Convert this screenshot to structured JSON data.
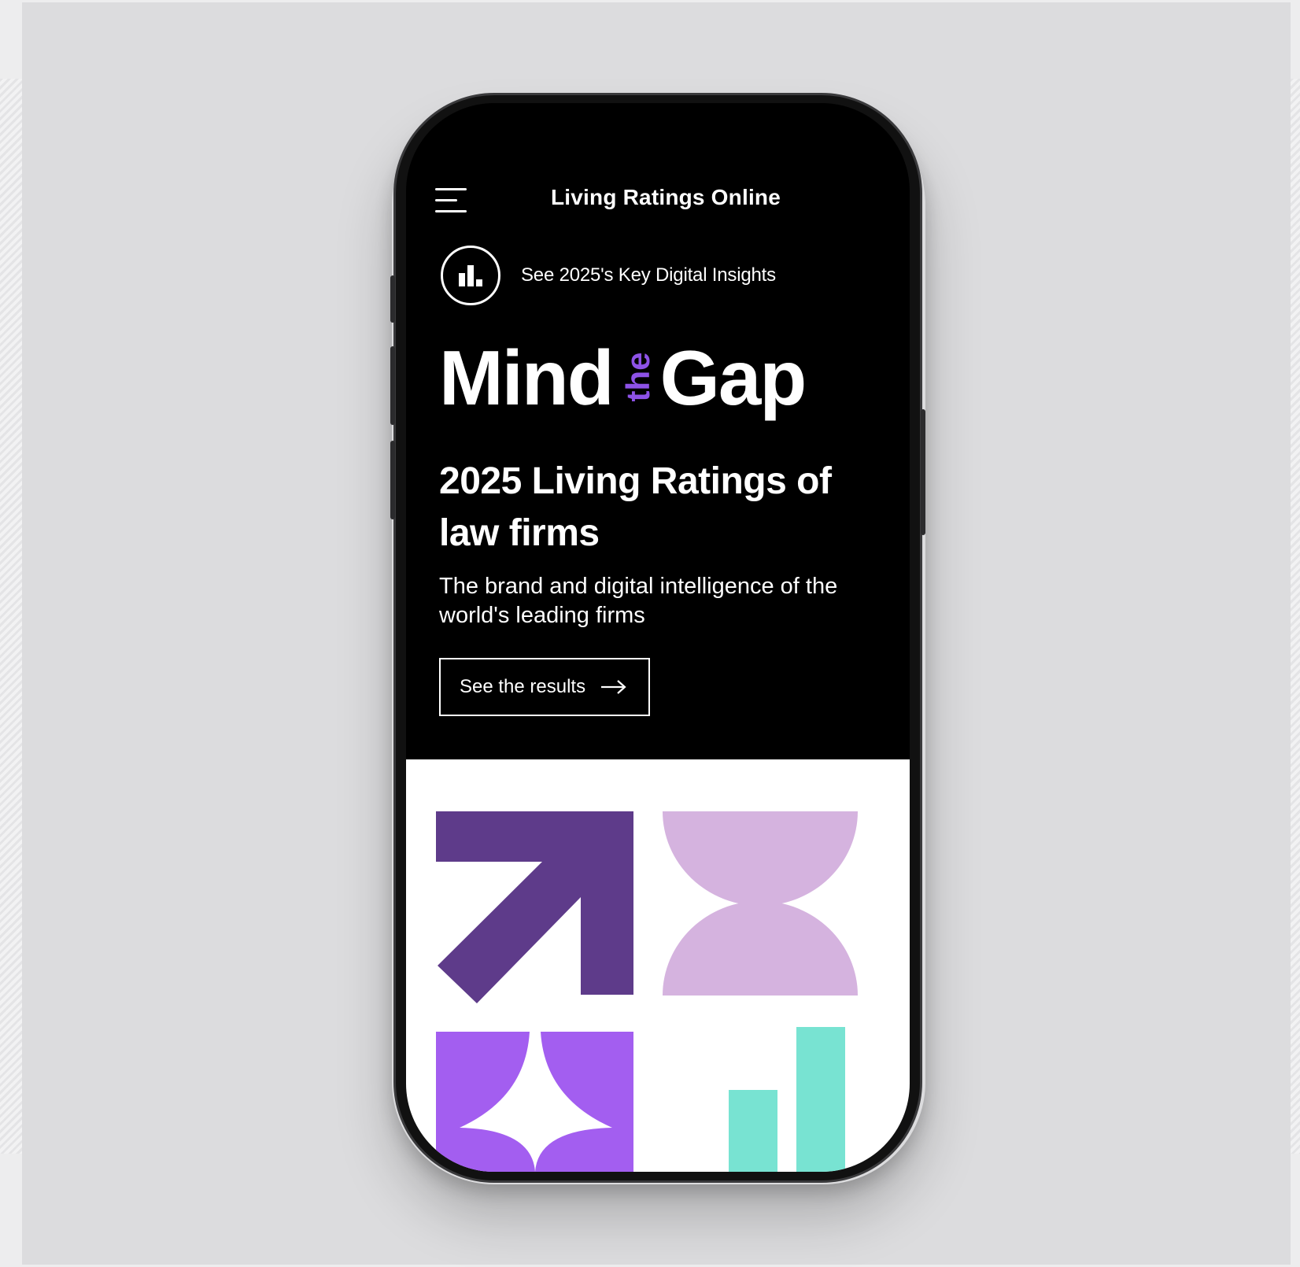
{
  "app": {
    "title": "Living Ratings Online"
  },
  "banner": {
    "icon": "bar-chart-icon",
    "text": "See 2025's Key Digital Insights"
  },
  "hero": {
    "word_left": "Mind",
    "word_middle": "the",
    "word_right": "Gap"
  },
  "headline": "2025 Living Ratings of law firms",
  "subheadline": "The brand and digital intelligence of the world's leading firms",
  "cta": {
    "label": "See the results",
    "icon": "arrow-right-icon"
  },
  "colors": {
    "background": "#000000",
    "text": "#ffffff",
    "accent_purple": "#8d52e6",
    "deep_purple": "#5e3b8a",
    "lilac": "#d5b3df",
    "violet": "#a35ef0",
    "teal": "#78e3d2"
  }
}
